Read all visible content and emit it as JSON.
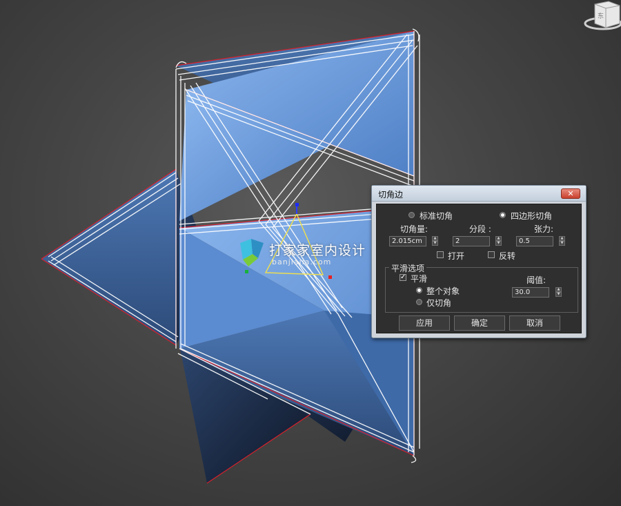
{
  "viewport": {
    "watermark_title": "打家家室内设计",
    "watermark_url": "banjiajia.com",
    "viewcube_label": "东"
  },
  "dialog": {
    "title": "切角边",
    "close_label": "✕",
    "mode_options": [
      {
        "label": "标准切角",
        "selected": false
      },
      {
        "label": "四边形切角",
        "selected": true
      }
    ],
    "amount": {
      "label": "切角量:",
      "value": "2.015cm"
    },
    "segments": {
      "label": "分段 :",
      "value": "2"
    },
    "tension": {
      "label": "张力:",
      "value": "0.5"
    },
    "open": {
      "label": "打开",
      "checked": false
    },
    "invert": {
      "label": "反转",
      "checked": false
    },
    "smooth_group": {
      "title": "平滑选项",
      "smooth": {
        "label": "平滑",
        "checked": true
      },
      "scope_options": [
        {
          "label": "整个对象",
          "selected": true
        },
        {
          "label": "仅切角",
          "selected": false
        }
      ],
      "threshold": {
        "label": "阈值:",
        "value": "30.0"
      }
    },
    "buttons": {
      "apply": "应用",
      "ok": "确定",
      "cancel": "取消"
    }
  },
  "colors": {
    "face_light": "#6e9fe0",
    "face_dark": "#1c2c47",
    "edge_red": "#d8202a",
    "wire_white": "#ffffff",
    "dialog_bg": "#2f2f2f"
  }
}
